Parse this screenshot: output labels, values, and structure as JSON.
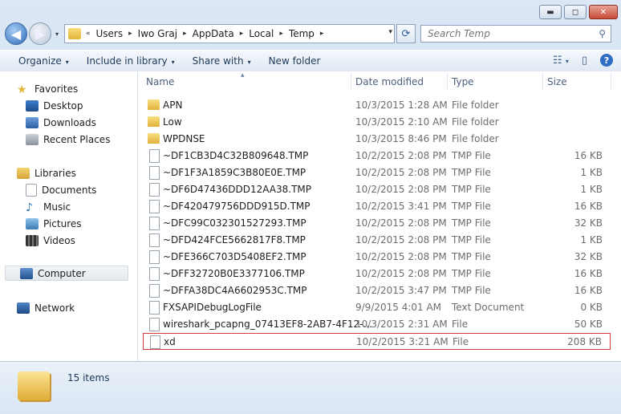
{
  "window": {
    "minimize": "▬",
    "maximize": "◻",
    "close": "✕"
  },
  "nav": {
    "back_glyph": "◀",
    "forward_glyph": "▶",
    "recent_glyph": "▾",
    "breadcrumb": [
      "«",
      "Users",
      "Iwo Graj",
      "AppData",
      "Local",
      "Temp"
    ],
    "crumb_sep": "▸",
    "address_drop": "▾",
    "refresh_glyph": "⟳",
    "search_placeholder": "Search Temp",
    "search_glyph": "⚲"
  },
  "toolbar": {
    "organize": "Organize",
    "include": "Include in library",
    "share": "Share with",
    "new_folder": "New folder",
    "caret": "▾",
    "views_glyph": "☷",
    "views_caret": "▾",
    "preview_glyph": "▯",
    "help_glyph": "?"
  },
  "sidebar": {
    "favorites": "Favorites",
    "desktop": "Desktop",
    "downloads": "Downloads",
    "recent": "Recent Places",
    "libraries": "Libraries",
    "documents": "Documents",
    "music": "Music",
    "pictures": "Pictures",
    "videos": "Videos",
    "computer": "Computer",
    "network": "Network"
  },
  "columns": {
    "name": "Name",
    "date": "Date modified",
    "type": "Type",
    "size": "Size",
    "sort_glyph": "▴"
  },
  "files": [
    {
      "name": "APN",
      "date": "10/3/2015 1:28 AM",
      "type": "File folder",
      "size": "",
      "icon": "folder-icon"
    },
    {
      "name": "Low",
      "date": "10/3/2015 2:10 AM",
      "type": "File folder",
      "size": "",
      "icon": "folder-icon"
    },
    {
      "name": "WPDNSE",
      "date": "10/3/2015 8:46 PM",
      "type": "File folder",
      "size": "",
      "icon": "folder-icon"
    },
    {
      "name": "~DF1CB3D4C32B809648.TMP",
      "date": "10/2/2015 2:08 PM",
      "type": "TMP File",
      "size": "16 KB",
      "icon": "file-icon"
    },
    {
      "name": "~DF1F3A1859C3B80E0E.TMP",
      "date": "10/2/2015 2:08 PM",
      "type": "TMP File",
      "size": "1 KB",
      "icon": "file-icon"
    },
    {
      "name": "~DF6D47436DDD12AA38.TMP",
      "date": "10/2/2015 2:08 PM",
      "type": "TMP File",
      "size": "1 KB",
      "icon": "file-icon"
    },
    {
      "name": "~DF420479756DDD915D.TMP",
      "date": "10/2/2015 3:41 PM",
      "type": "TMP File",
      "size": "16 KB",
      "icon": "file-icon"
    },
    {
      "name": "~DFC99C032301527293.TMP",
      "date": "10/2/2015 2:08 PM",
      "type": "TMP File",
      "size": "32 KB",
      "icon": "file-icon"
    },
    {
      "name": "~DFD424FCE5662817F8.TMP",
      "date": "10/2/2015 2:08 PM",
      "type": "TMP File",
      "size": "1 KB",
      "icon": "file-icon"
    },
    {
      "name": "~DFE366C703D5408EF2.TMP",
      "date": "10/2/2015 2:08 PM",
      "type": "TMP File",
      "size": "32 KB",
      "icon": "file-icon"
    },
    {
      "name": "~DFF32720B0E3377106.TMP",
      "date": "10/2/2015 2:08 PM",
      "type": "TMP File",
      "size": "16 KB",
      "icon": "file-icon"
    },
    {
      "name": "~DFFA38DC4A6602953C.TMP",
      "date": "10/2/2015 3:47 PM",
      "type": "TMP File",
      "size": "16 KB",
      "icon": "file-icon"
    },
    {
      "name": "FXSAPIDebugLogFile",
      "date": "9/9/2015 4:01 AM",
      "type": "Text Document",
      "size": "0 KB",
      "icon": "text-file-icon"
    },
    {
      "name": "wireshark_pcapng_07413EF8-2AB7-4F12-...",
      "date": "10/3/2015 2:31 AM",
      "type": "File",
      "size": "50 KB",
      "icon": "file-icon"
    },
    {
      "name": "xd",
      "date": "10/2/2015 3:21 AM",
      "type": "File",
      "size": "208 KB",
      "icon": "file-icon",
      "highlighted": true
    }
  ],
  "details": {
    "count": "15 items"
  },
  "colors": {
    "highlight_border": "#d63c3c",
    "toolbar_text": "#1e395b"
  }
}
